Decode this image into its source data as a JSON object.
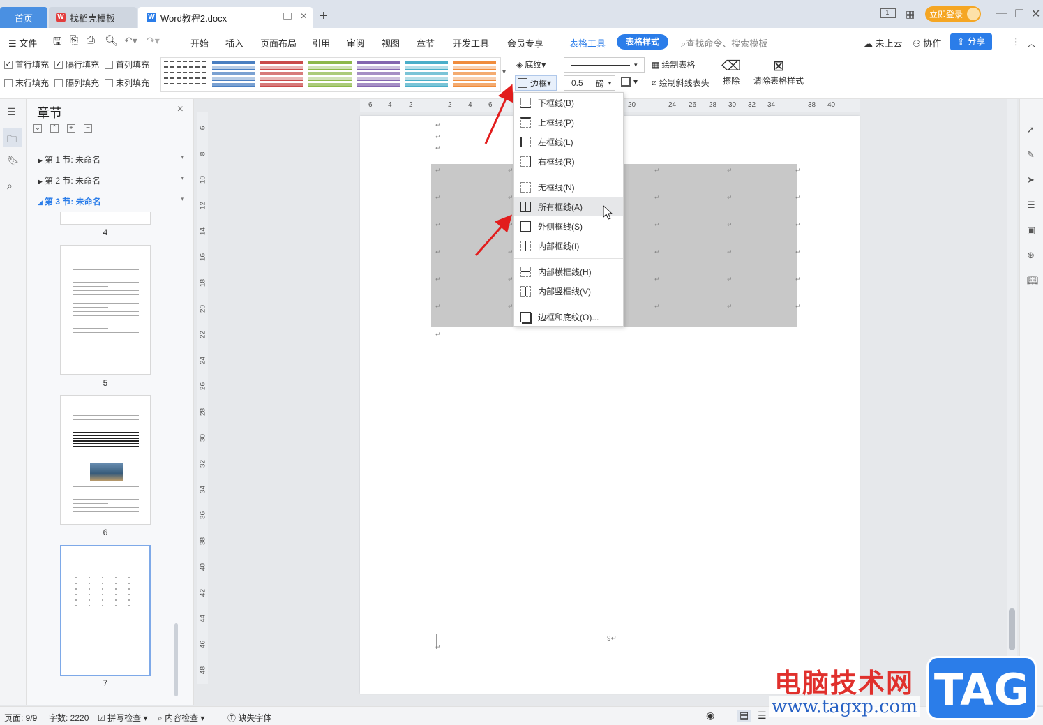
{
  "tabs": {
    "home": "首页",
    "template": "找稻壳模板",
    "doc": "Word教程2.docx",
    "login": "立即登录"
  },
  "menubar": {
    "file": "文件",
    "items": [
      "开始",
      "插入",
      "页面布局",
      "引用",
      "审阅",
      "视图",
      "章节",
      "开发工具",
      "会员专享"
    ],
    "table_tool": "表格工具",
    "table_style": "表格样式",
    "search": "查找命令、搜索模板",
    "cloud": "未上云",
    "collab": "协作",
    "share": "分享"
  },
  "ribbon": {
    "checks": [
      {
        "label": "首行填充",
        "checked": true
      },
      {
        "label": "隔行填充",
        "checked": true
      },
      {
        "label": "首列填充",
        "checked": false
      },
      {
        "label": "末行填充",
        "checked": false
      },
      {
        "label": "隔列填充",
        "checked": false
      },
      {
        "label": "末列填充",
        "checked": false
      }
    ],
    "shading": "底纹",
    "border": "边框",
    "line_width": "0.5",
    "unit": "磅",
    "draw_table": "绘制表格",
    "draw_diagonal": "绘制斜线表头",
    "erase": "擦除",
    "clear_style": "清除表格样式",
    "style_colors": [
      "#555555",
      "#4a7fc1",
      "#c94a4a",
      "#8db84a",
      "#8466b0",
      "#4aaec9",
      "#f08c3c"
    ]
  },
  "chapter_panel": {
    "title": "章节",
    "sections": [
      "第 1 节: 未命名",
      "第 2 节: 未命名",
      "第 3 节: 未命名"
    ],
    "page_numbers": [
      "4",
      "5",
      "6",
      "7"
    ]
  },
  "ruler": {
    "h": [
      "6",
      "4",
      "2",
      "2",
      "4",
      "6",
      "20",
      "24",
      "26",
      "28",
      "30",
      "32",
      "34",
      "38",
      "40"
    ],
    "v": [
      "6",
      "8",
      "10",
      "12",
      "14",
      "16",
      "18",
      "20",
      "22",
      "24",
      "26",
      "28",
      "30",
      "32",
      "34",
      "36",
      "38",
      "40",
      "42",
      "44",
      "46",
      "48"
    ]
  },
  "page": {
    "footer_num": "9"
  },
  "border_menu": {
    "items": [
      "下框线(B)",
      "上框线(P)",
      "左框线(L)",
      "右框线(R)",
      "无框线(N)",
      "所有框线(A)",
      "外侧框线(S)",
      "内部框线(I)",
      "内部横框线(H)",
      "内部竖框线(V)",
      "边框和底纹(O)..."
    ],
    "hovered": "所有框线(A)"
  },
  "statusbar": {
    "page": "页面: 9/9",
    "words": "字数: 2220",
    "spell": "拼写检查",
    "content_check": "内容检查",
    "missing_font": "缺失字体"
  },
  "watermark": {
    "text": "电脑技术网",
    "url": "www.tagxp.com",
    "logo": "TAG"
  }
}
